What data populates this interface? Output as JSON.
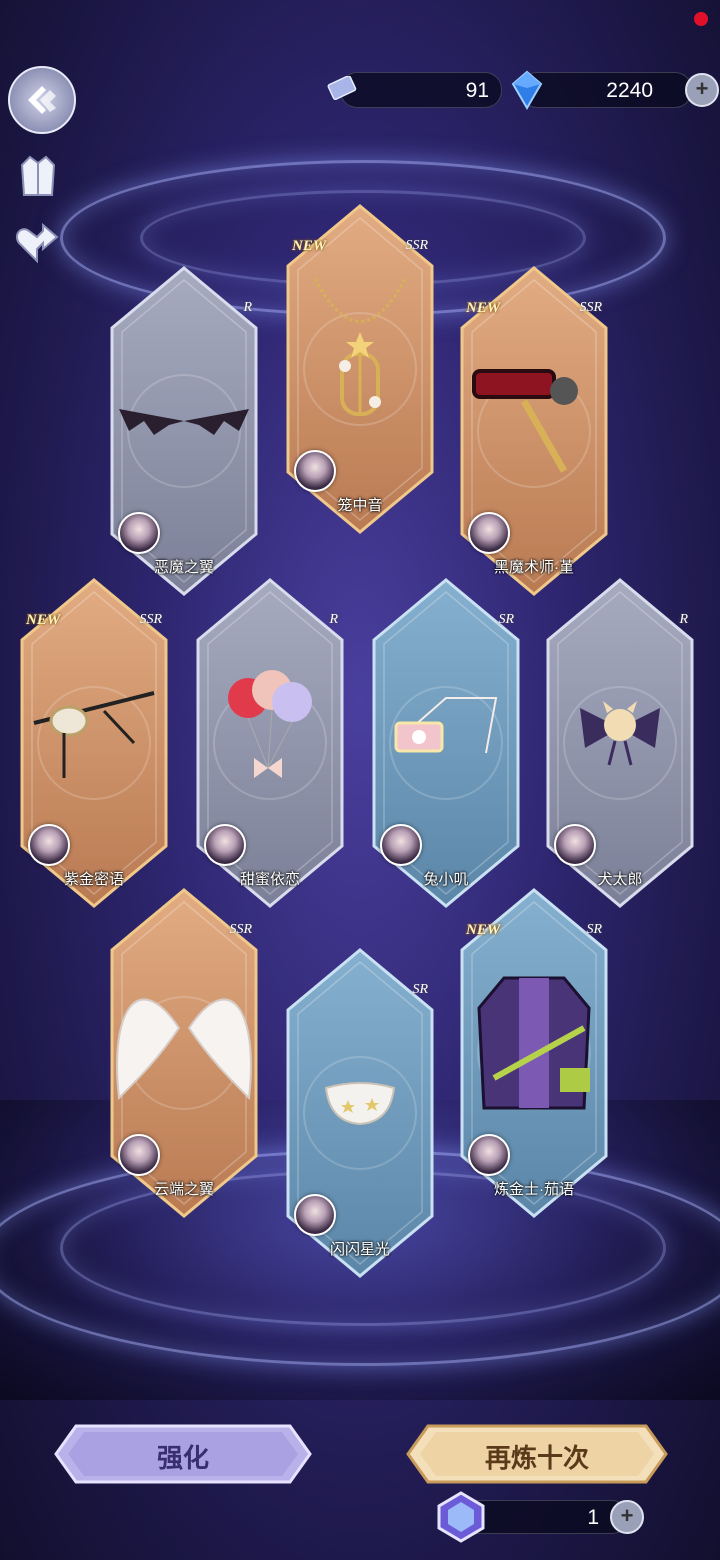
{
  "currency": {
    "tickets": "91",
    "crystals": "2240"
  },
  "cards": [
    {
      "name": "恶魔之翼",
      "rarity": "R",
      "new": "",
      "tone": "gray",
      "item": "bat-wings-icon"
    },
    {
      "name": "笼中音",
      "rarity": "SSR",
      "new": "NEW",
      "tone": "gold",
      "item": "cage-necklace-icon"
    },
    {
      "name": "黑魔术师·堇",
      "rarity": "SSR",
      "new": "NEW",
      "tone": "gold",
      "item": "magician-hat-wand-icon"
    },
    {
      "name": "紫金密语",
      "rarity": "SSR",
      "new": "NEW",
      "tone": "gold",
      "item": "eyepatch-chain-icon"
    },
    {
      "name": "甜蜜依恋",
      "rarity": "R",
      "new": "",
      "tone": "gray",
      "item": "balloons-icon"
    },
    {
      "name": "兔小叽",
      "rarity": "SR",
      "new": "",
      "tone": "blue",
      "item": "rabbit-pouch-icon"
    },
    {
      "name": "犬太郎",
      "rarity": "R",
      "new": "",
      "tone": "gray",
      "item": "dog-bow-icon"
    },
    {
      "name": "云端之翼",
      "rarity": "SSR",
      "new": "",
      "tone": "gold",
      "item": "angel-wings-icon"
    },
    {
      "name": "闪闪星光",
      "rarity": "SR",
      "new": "",
      "tone": "blue",
      "item": "star-mask-icon"
    },
    {
      "name": "炼金士·茄语",
      "rarity": "SR",
      "new": "NEW",
      "tone": "blue",
      "item": "alchemist-coat-icon"
    }
  ],
  "buttons": {
    "enhance": "强化",
    "refine_ten": "再炼十次"
  },
  "token_count": "1",
  "colors": {
    "gold_card": "#c89066",
    "gray_card": "#8e93a8",
    "blue_card": "#6d97b8"
  }
}
